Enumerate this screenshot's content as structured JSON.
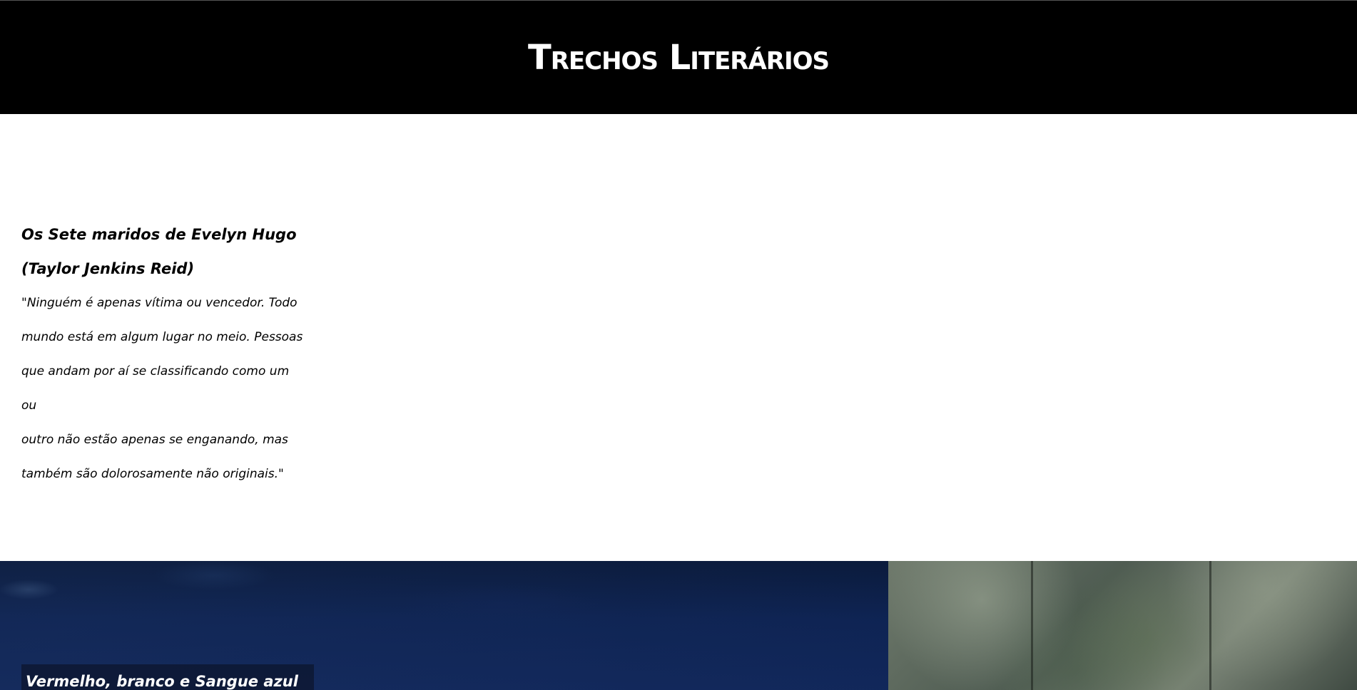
{
  "header": {
    "title": "Trechos Literários"
  },
  "excerpts": [
    {
      "book_title": "Os Sete maridos de Evelyn Hugo",
      "author": "(Taylor Jenkins Reid)",
      "quote_lines": [
        "\"Ninguém é apenas vítima ou vencedor. Todo",
        "mundo está em algum lugar no meio. Pessoas",
        "que andam por aí se classificando como um ou",
        "outro não estão apenas se enganando, mas",
        "também são dolorosamente não originais.\""
      ]
    },
    {
      "book_title": "Vermelho, branco e Sangue azul"
    }
  ],
  "colors": {
    "header_bg": "#000000",
    "header_text": "#ffffff",
    "body_bg": "#ffffff",
    "water": "#0f2556"
  }
}
